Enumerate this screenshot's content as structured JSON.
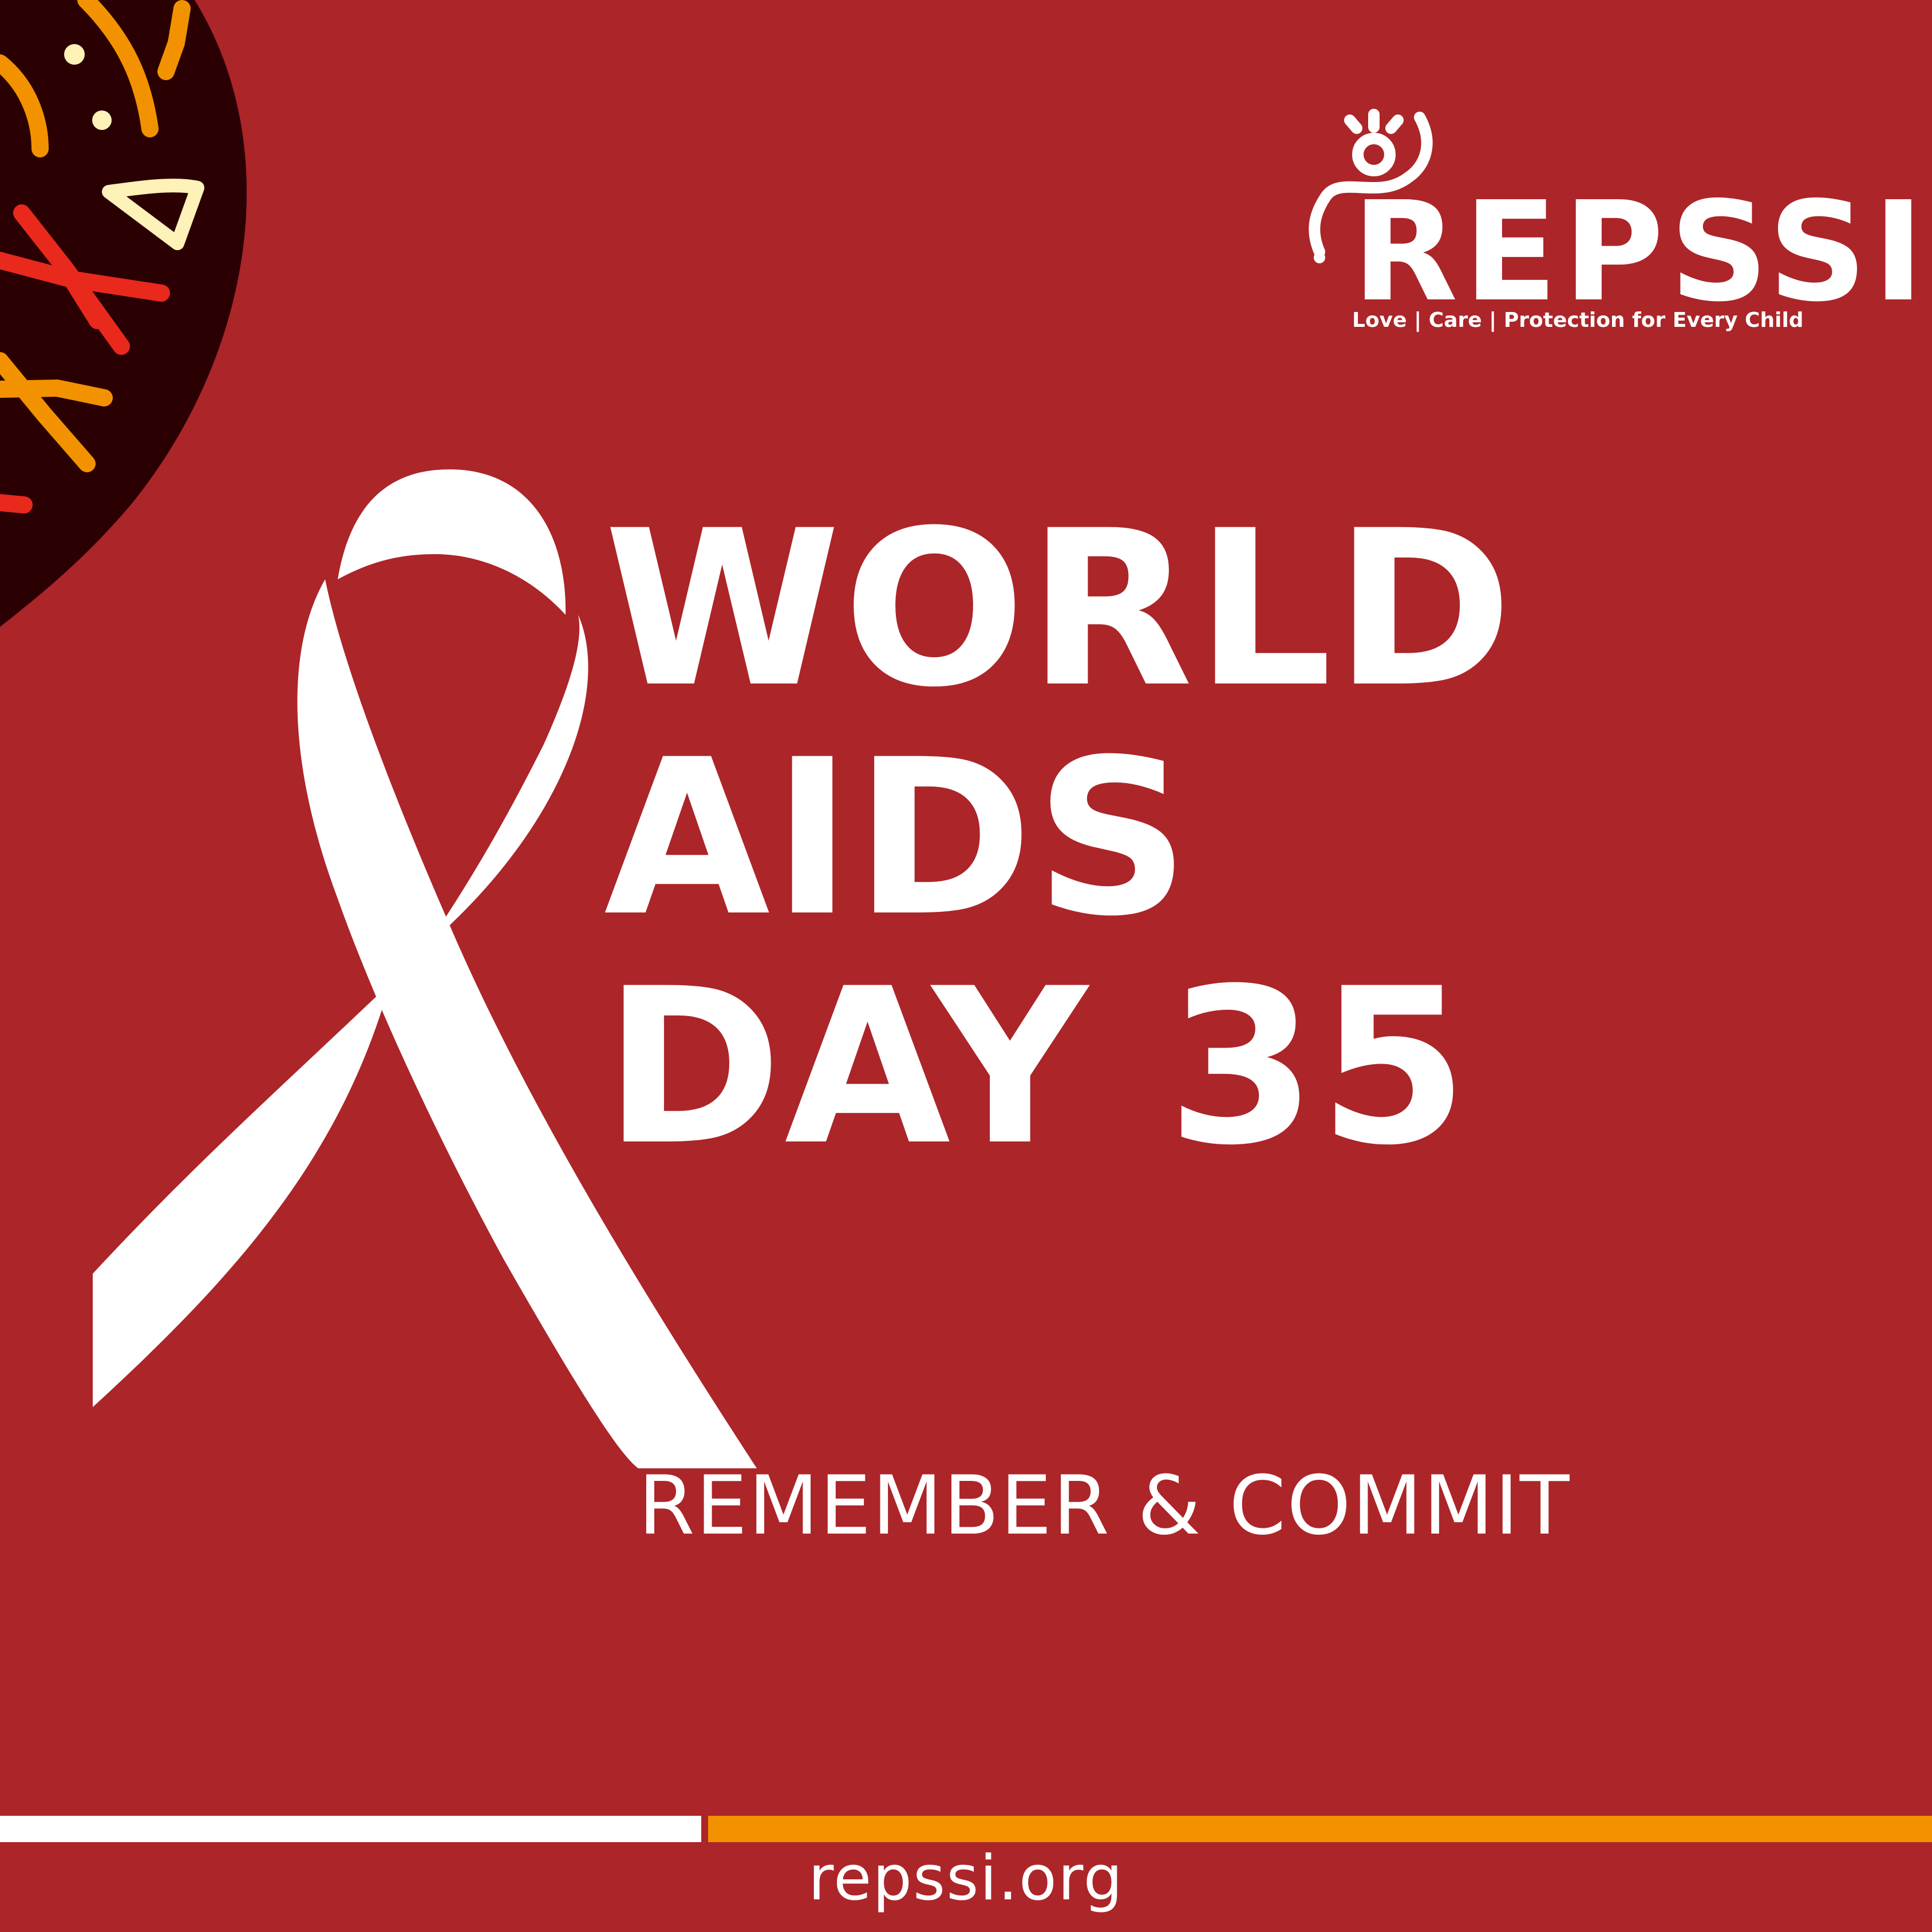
{
  "colors": {
    "background": "#AC2529",
    "text": "#FFFFFF",
    "pattern_dark": "#2A0003",
    "pattern_orange": "#F39200",
    "pattern_red": "#E8291C",
    "pattern_yellow": "#FFF2B8",
    "bar_left": "#FFFFFF",
    "bar_right": "#F39200"
  },
  "logo": {
    "name": "REPSSI",
    "tagline": "Love | Care | Protection for Every Child",
    "icon": "child-figure-icon"
  },
  "headline": {
    "line1": "WORLD",
    "line2": "AIDS",
    "line3": "DAY 35"
  },
  "subtitle": "REMEMBER & COMMIT",
  "ribbon_icon": "awareness-ribbon-icon",
  "pattern_icon": "decorative-pattern-shape",
  "footer": {
    "url": "repssi.org"
  }
}
